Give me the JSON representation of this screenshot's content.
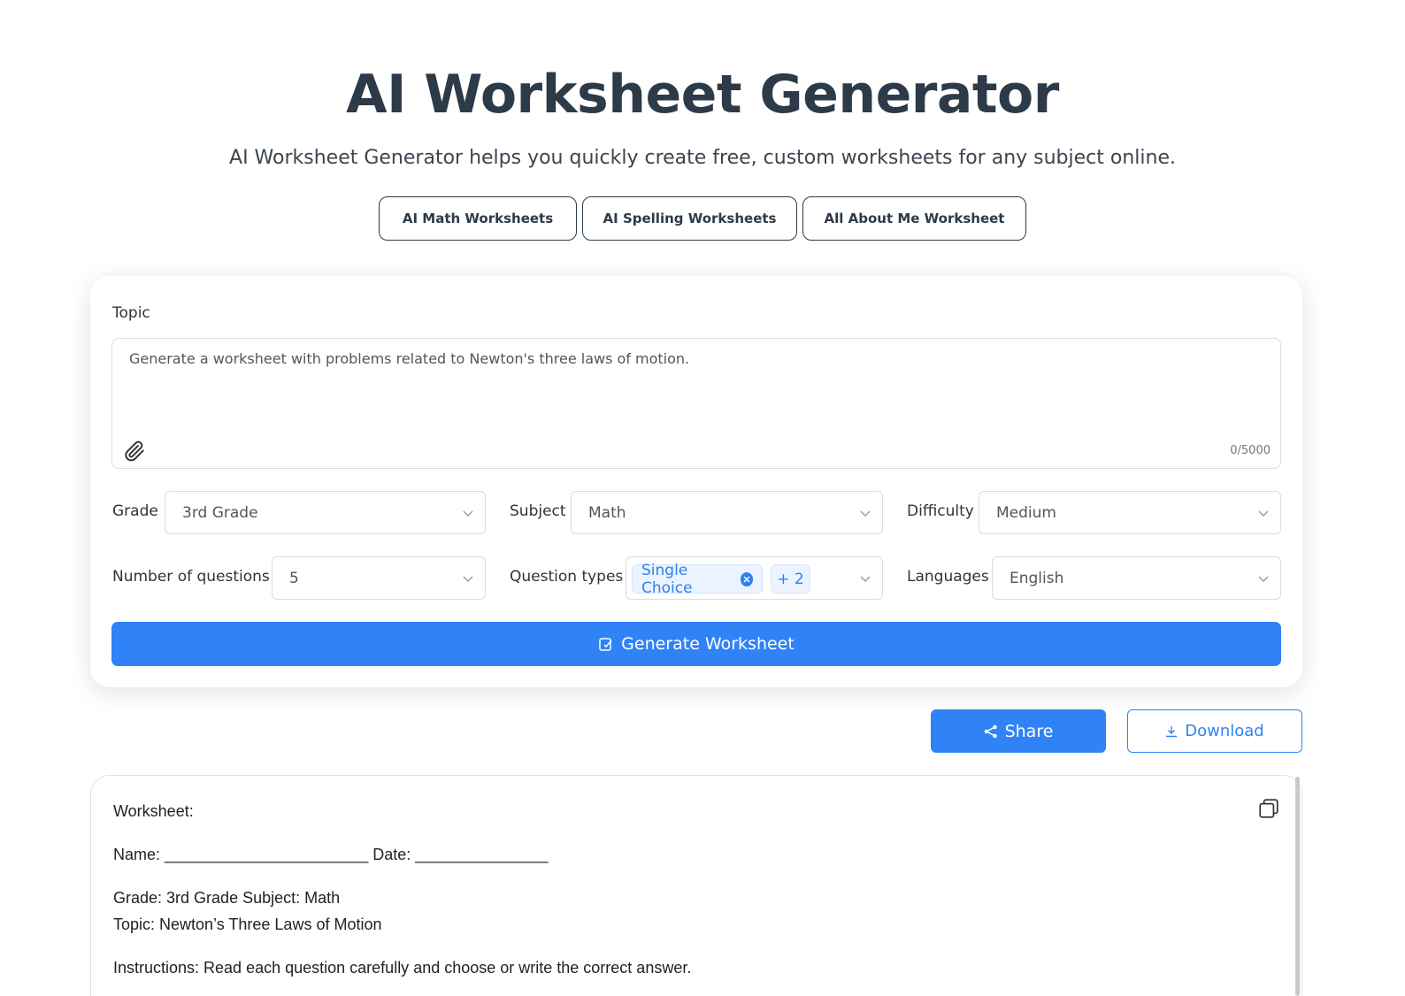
{
  "header": {
    "title": "AI Worksheet Generator",
    "subtitle": "AI Worksheet Generator helps you quickly create free, custom worksheets for any subject online."
  },
  "quick_links": [
    "AI Math Worksheets",
    "AI Spelling Worksheets",
    "All About Me Worksheet"
  ],
  "form": {
    "topic_label": "Topic",
    "topic_placeholder": "Generate a worksheet with problems related to Newton's three laws of motion.",
    "topic_value": "",
    "char_counter": "0/5000",
    "grade_label": "Grade",
    "grade_value": "3rd Grade",
    "subject_label": "Subject",
    "subject_value": "Math",
    "difficulty_label": "Difficulty",
    "difficulty_value": "Medium",
    "num_questions_label": "Number of questions",
    "num_questions_value": "5",
    "question_types_label": "Question types",
    "question_type_tag": "Single Choice",
    "question_type_more": "+ 2",
    "languages_label": "Languages",
    "languages_value": "English",
    "generate_label": "Generate Worksheet"
  },
  "actions": {
    "share_label": "Share",
    "download_label": "Download"
  },
  "worksheet": {
    "heading": "Worksheet:",
    "name_line": "Name: _______________________ Date: _______________",
    "grade_subject": "Grade: 3rd Grade Subject: Math",
    "topic": "Topic: Newton’s Three Laws of Motion",
    "instructions": "Instructions: Read each question carefully and choose or write the correct answer."
  },
  "colors": {
    "primary": "#2f83f7",
    "title": "#2d3a48",
    "tag_bg": "#eaf3ff"
  }
}
